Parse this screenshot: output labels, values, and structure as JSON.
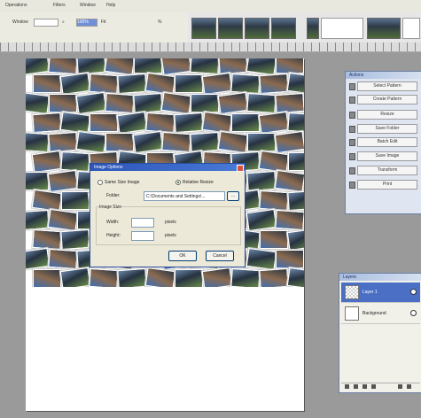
{
  "menu": {
    "items": [
      "Operations",
      "Filters",
      "Window",
      "Help"
    ]
  },
  "options": {
    "mode_label": "Window",
    "zoom_value": "100%",
    "fit_label": "Fit",
    "percent_label": "%"
  },
  "dialog": {
    "title": "Image Options",
    "radio_1_label": "Same Size Image",
    "radio_2_label": "Relative Resize",
    "folder_label": "Folder:",
    "folder_value": "C:\\Documents and Settings\\...",
    "group_label": "Image Size",
    "width_label": "Width:",
    "height_label": "Height:",
    "width_unit": "pixels",
    "height_unit": "pixels",
    "ok_label": "OK",
    "cancel_label": "Cancel"
  },
  "actions_panel": {
    "title": "Actions",
    "items": [
      "Select Pattern",
      "Create Pattern",
      "Resize",
      "Save Folder",
      "Batch Edit",
      "Save Image",
      "Transform",
      "Print"
    ]
  },
  "layers_panel": {
    "title": "Layers",
    "layers": [
      "Layer 1",
      "Background"
    ]
  }
}
